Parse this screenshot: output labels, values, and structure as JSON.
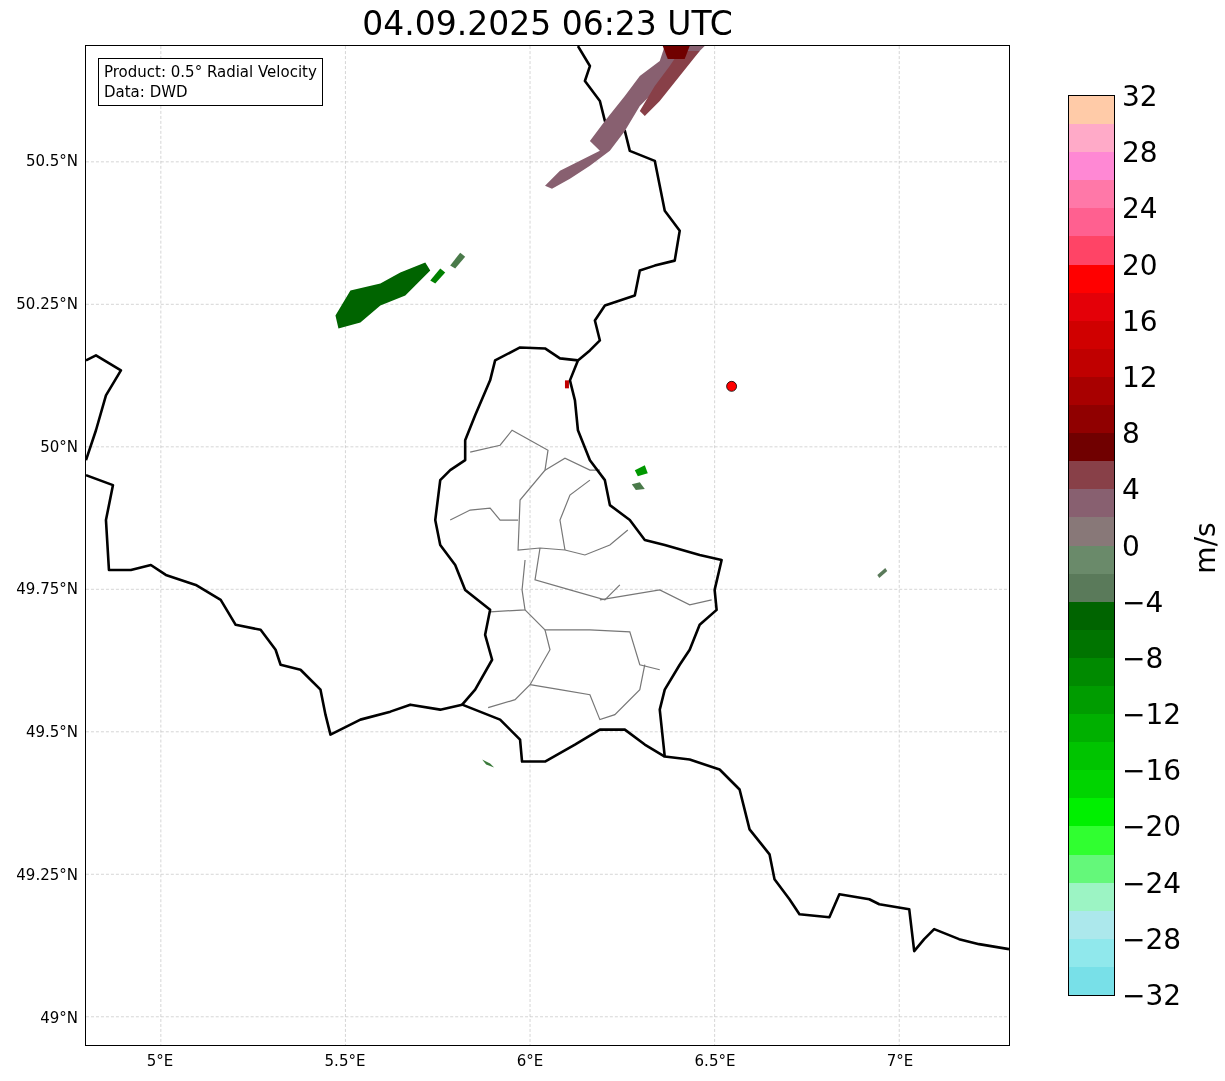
{
  "title": "04.09.2025 06:23 UTC",
  "legend": {
    "lines": [
      "Product: 0.5° Radial Velocity",
      "Data: DWD"
    ]
  },
  "x_ticks": [
    "5°E",
    "5.5°E",
    "6°E",
    "6.5°E",
    "7°E"
  ],
  "y_ticks": [
    "50.5°N",
    "50.25°N",
    "50°N",
    "49.75°N",
    "49.5°N",
    "49.25°N",
    "49°N"
  ],
  "colorbar": {
    "label": "m/s",
    "ticks": [
      "32",
      "28",
      "24",
      "20",
      "16",
      "12",
      "8",
      "4",
      "0",
      "−4",
      "−8",
      "−12",
      "−16",
      "−20",
      "−24",
      "−28",
      "−32"
    ],
    "bands": [
      {
        "color": "#ffcba8"
      },
      {
        "color": "#ffaac8"
      },
      {
        "color": "#ff88d4"
      },
      {
        "color": "#ff78a8"
      },
      {
        "color": "#ff6090"
      },
      {
        "color": "#ff4466"
      },
      {
        "color": "#ff0000"
      },
      {
        "color": "#e40008"
      },
      {
        "color": "#d00000"
      },
      {
        "color": "#c00000"
      },
      {
        "color": "#a80000"
      },
      {
        "color": "#900000"
      },
      {
        "color": "#700000"
      },
      {
        "color": "#884048"
      },
      {
        "color": "#886070"
      },
      {
        "color": "#887878"
      },
      {
        "color": "#6a8a6a"
      },
      {
        "color": "#5a7a5a"
      },
      {
        "color": "#006400"
      },
      {
        "color": "#007400"
      },
      {
        "color": "#008a00"
      },
      {
        "color": "#009c00"
      },
      {
        "color": "#00b000"
      },
      {
        "color": "#00c400"
      },
      {
        "color": "#00d400"
      },
      {
        "color": "#00f000"
      },
      {
        "color": "#30ff30"
      },
      {
        "color": "#64f87a"
      },
      {
        "color": "#9cf4c4"
      },
      {
        "color": "#ace8ec"
      },
      {
        "color": "#90e8ec"
      },
      {
        "color": "#78e0e8"
      }
    ]
  }
}
